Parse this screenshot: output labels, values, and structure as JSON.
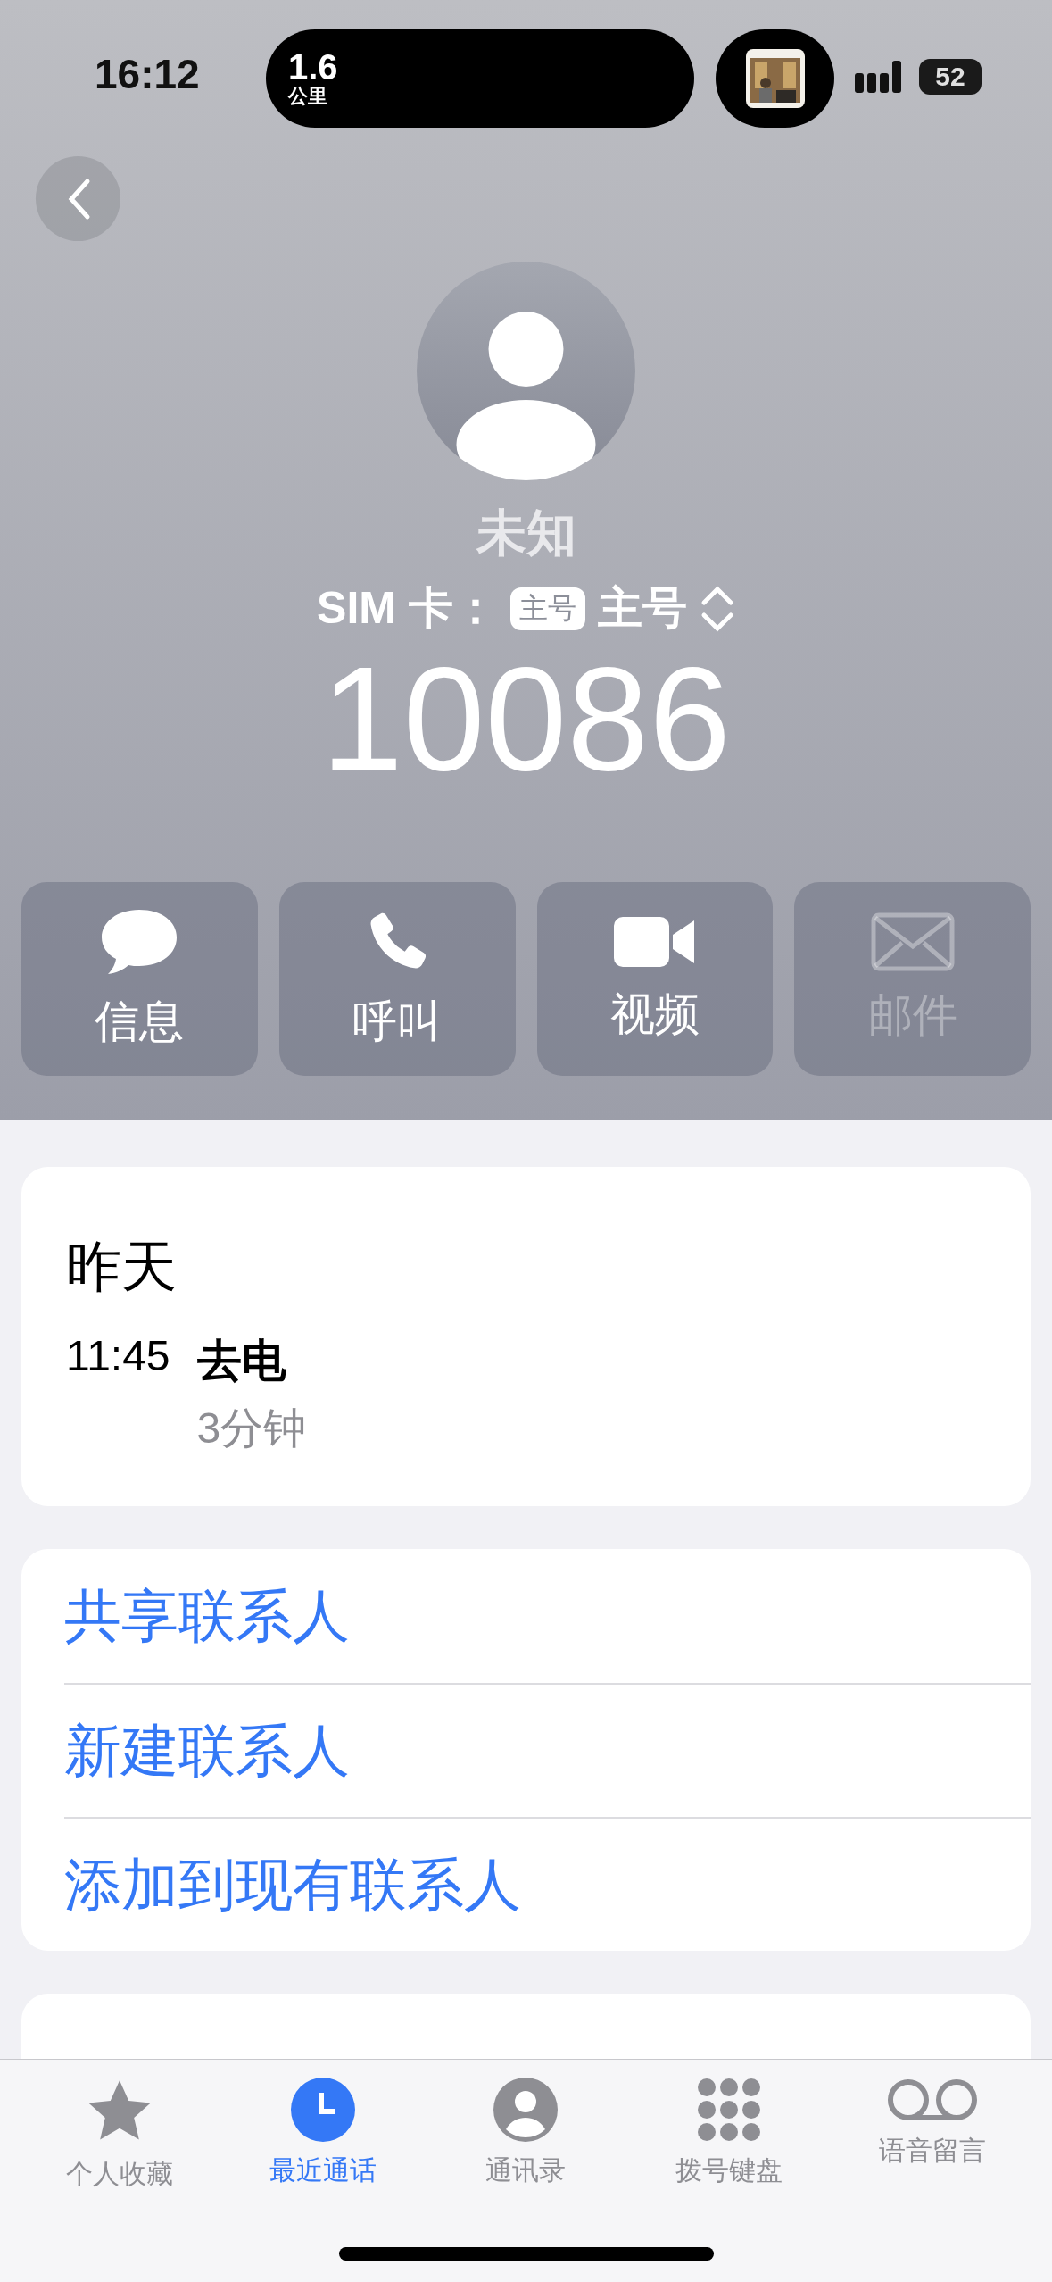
{
  "status_bar": {
    "time": "16:12",
    "live_activity": {
      "value": "1.6",
      "unit": "公里"
    },
    "battery": "52"
  },
  "contact": {
    "name": "未知",
    "sim_label": "SIM 卡：",
    "sim_badge": "主号",
    "sim_value": "主号",
    "number": "10086"
  },
  "actions": [
    {
      "label": "信息",
      "kind": "message",
      "disabled": false
    },
    {
      "label": "呼叫",
      "kind": "call",
      "disabled": false
    },
    {
      "label": "视频",
      "kind": "video",
      "disabled": false
    },
    {
      "label": "邮件",
      "kind": "mail",
      "disabled": true
    }
  ],
  "call_log": {
    "date": "昨天",
    "entries": [
      {
        "time": "11:45",
        "type": "去电",
        "duration": "3分钟"
      }
    ]
  },
  "contact_actions": [
    "共享联系人",
    "新建联系人",
    "添加到现有联系人"
  ],
  "tab_bar": [
    {
      "label": "个人收藏",
      "kind": "favorites",
      "selected": false
    },
    {
      "label": "最近通话",
      "kind": "recents",
      "selected": true
    },
    {
      "label": "通讯录",
      "kind": "contacts",
      "selected": false
    },
    {
      "label": "拨号键盘",
      "kind": "keypad",
      "selected": false
    },
    {
      "label": "语音留言",
      "kind": "voicemail",
      "selected": false
    }
  ]
}
